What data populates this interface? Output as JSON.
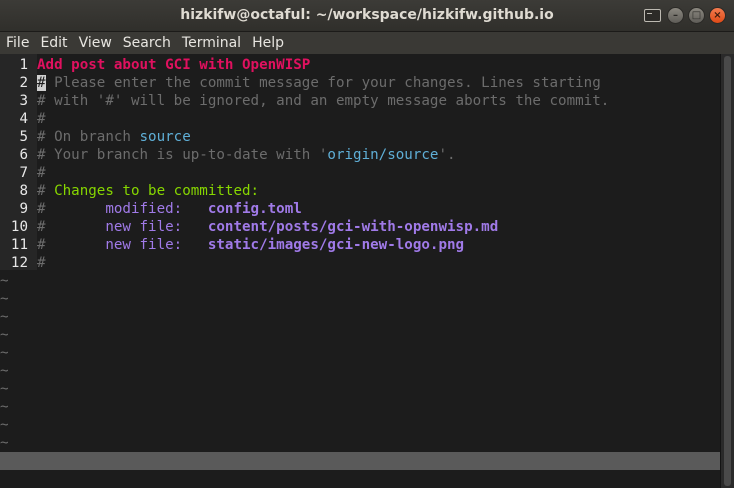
{
  "window": {
    "title": "hizkifw@octaful: ~/workspace/hizkifw.github.io",
    "controls": {
      "minimize": "–",
      "maximize": "□",
      "close": "×"
    }
  },
  "menu": [
    "File",
    "Edit",
    "View",
    "Search",
    "Terminal",
    "Help"
  ],
  "editor": {
    "lines": [
      {
        "n": "1",
        "segments": [
          {
            "t": "Add post about GCI with OpenWISP",
            "c": "c-subject"
          }
        ]
      },
      {
        "n": "2",
        "segments": [
          {
            "t": "#",
            "c": "cursor"
          },
          {
            "t": " Please enter the commit message for your changes. Lines starting",
            "c": "c-comment"
          }
        ]
      },
      {
        "n": "3",
        "segments": [
          {
            "t": "# with '#' will be ignored, and an empty message aborts the commit.",
            "c": "c-comment"
          }
        ]
      },
      {
        "n": "4",
        "segments": [
          {
            "t": "#",
            "c": "c-comment"
          }
        ]
      },
      {
        "n": "5",
        "segments": [
          {
            "t": "# On branch ",
            "c": "c-comment"
          },
          {
            "t": "source",
            "c": "c-branch"
          }
        ]
      },
      {
        "n": "6",
        "segments": [
          {
            "t": "# Your branch is up-to-date with '",
            "c": "c-comment"
          },
          {
            "t": "origin/source",
            "c": "c-branch"
          },
          {
            "t": "'.",
            "c": "c-comment"
          }
        ]
      },
      {
        "n": "7",
        "segments": [
          {
            "t": "#",
            "c": "c-comment"
          }
        ]
      },
      {
        "n": "8",
        "segments": [
          {
            "t": "# ",
            "c": "c-comment"
          },
          {
            "t": "Changes to be committed:",
            "c": "c-changes"
          }
        ]
      },
      {
        "n": "9",
        "segments": [
          {
            "t": "#",
            "c": "c-comment"
          },
          {
            "t": "       modified:   ",
            "c": "c-type"
          },
          {
            "t": "config.toml",
            "c": "c-file"
          }
        ]
      },
      {
        "n": "10",
        "segments": [
          {
            "t": "#",
            "c": "c-comment"
          },
          {
            "t": "       new file:   ",
            "c": "c-type"
          },
          {
            "t": "content/posts/gci-with-openwisp.md",
            "c": "c-file"
          }
        ]
      },
      {
        "n": "11",
        "segments": [
          {
            "t": "#",
            "c": "c-comment"
          },
          {
            "t": "       new file:   ",
            "c": "c-type"
          },
          {
            "t": "static/images/gci-new-logo.png",
            "c": "c-file"
          }
        ]
      },
      {
        "n": "12",
        "segments": [
          {
            "t": "#",
            "c": "c-comment"
          }
        ]
      }
    ],
    "empty_line_marker": "~",
    "empty_line_count": 10
  },
  "colors": {
    "subject": "#e0115f",
    "comment": "#6c6c6c",
    "branch": "#5fafd7",
    "changes": "#87d700",
    "file": "#a07ae8"
  }
}
